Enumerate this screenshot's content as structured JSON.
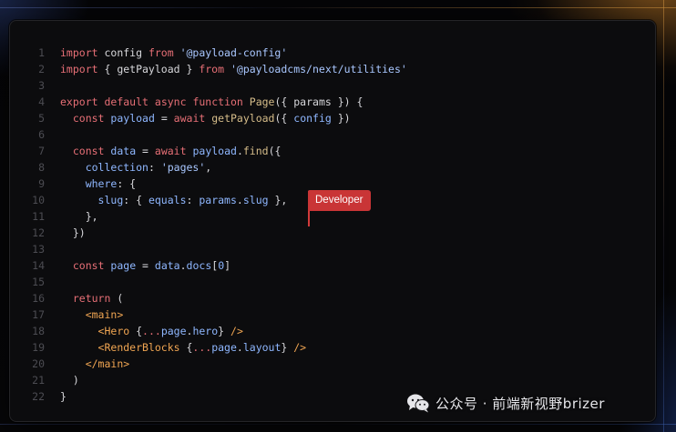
{
  "editor": {
    "lines": [
      {
        "num": "1",
        "tokens": [
          {
            "t": "import",
            "c": "kw"
          },
          {
            "t": " config ",
            "c": "punc"
          },
          {
            "t": "from",
            "c": "kw"
          },
          {
            "t": " ",
            "c": "punc"
          },
          {
            "t": "'@payload-config'",
            "c": "str"
          }
        ]
      },
      {
        "num": "2",
        "tokens": [
          {
            "t": "import",
            "c": "kw"
          },
          {
            "t": " { getPayload } ",
            "c": "punc"
          },
          {
            "t": "from",
            "c": "kw"
          },
          {
            "t": " ",
            "c": "punc"
          },
          {
            "t": "'@payloadcms/next/utilities'",
            "c": "str"
          }
        ]
      },
      {
        "num": "3",
        "tokens": []
      },
      {
        "num": "4",
        "tokens": [
          {
            "t": "export",
            "c": "kw"
          },
          {
            "t": " ",
            "c": "punc"
          },
          {
            "t": "default",
            "c": "kw"
          },
          {
            "t": " ",
            "c": "punc"
          },
          {
            "t": "async",
            "c": "kw"
          },
          {
            "t": " ",
            "c": "punc"
          },
          {
            "t": "function",
            "c": "kw"
          },
          {
            "t": " ",
            "c": "punc"
          },
          {
            "t": "Page",
            "c": "fn"
          },
          {
            "t": "({ params }) {",
            "c": "punc"
          }
        ]
      },
      {
        "num": "5",
        "tokens": [
          {
            "t": "  ",
            "c": "punc"
          },
          {
            "t": "const",
            "c": "kw"
          },
          {
            "t": " ",
            "c": "punc"
          },
          {
            "t": "payload",
            "c": "prop"
          },
          {
            "t": " = ",
            "c": "punc"
          },
          {
            "t": "await",
            "c": "kw"
          },
          {
            "t": " ",
            "c": "punc"
          },
          {
            "t": "getPayload",
            "c": "fn"
          },
          {
            "t": "({ ",
            "c": "punc"
          },
          {
            "t": "config",
            "c": "prop"
          },
          {
            "t": " })",
            "c": "punc"
          }
        ]
      },
      {
        "num": "6",
        "tokens": []
      },
      {
        "num": "7",
        "tokens": [
          {
            "t": "  ",
            "c": "punc"
          },
          {
            "t": "const",
            "c": "kw"
          },
          {
            "t": " ",
            "c": "punc"
          },
          {
            "t": "data",
            "c": "prop"
          },
          {
            "t": " = ",
            "c": "punc"
          },
          {
            "t": "await",
            "c": "kw"
          },
          {
            "t": " ",
            "c": "punc"
          },
          {
            "t": "payload",
            "c": "prop"
          },
          {
            "t": ".",
            "c": "punc"
          },
          {
            "t": "find",
            "c": "fn"
          },
          {
            "t": "({",
            "c": "punc"
          }
        ]
      },
      {
        "num": "8",
        "tokens": [
          {
            "t": "    ",
            "c": "punc"
          },
          {
            "t": "collection",
            "c": "prop"
          },
          {
            "t": ": ",
            "c": "punc"
          },
          {
            "t": "'pages'",
            "c": "str"
          },
          {
            "t": ",",
            "c": "punc"
          }
        ]
      },
      {
        "num": "9",
        "tokens": [
          {
            "t": "    ",
            "c": "punc"
          },
          {
            "t": "where",
            "c": "prop"
          },
          {
            "t": ": {",
            "c": "punc"
          }
        ]
      },
      {
        "num": "10",
        "tokens": [
          {
            "t": "      ",
            "c": "punc"
          },
          {
            "t": "slug",
            "c": "prop"
          },
          {
            "t": ": { ",
            "c": "punc"
          },
          {
            "t": "equals",
            "c": "prop"
          },
          {
            "t": ": ",
            "c": "punc"
          },
          {
            "t": "params",
            "c": "prop"
          },
          {
            "t": ".",
            "c": "punc"
          },
          {
            "t": "slug",
            "c": "prop"
          },
          {
            "t": " },",
            "c": "punc"
          }
        ]
      },
      {
        "num": "11",
        "tokens": [
          {
            "t": "    },",
            "c": "punc"
          }
        ]
      },
      {
        "num": "12",
        "tokens": [
          {
            "t": "  })",
            "c": "punc"
          }
        ]
      },
      {
        "num": "13",
        "tokens": []
      },
      {
        "num": "14",
        "tokens": [
          {
            "t": "  ",
            "c": "punc"
          },
          {
            "t": "const",
            "c": "kw"
          },
          {
            "t": " ",
            "c": "punc"
          },
          {
            "t": "page",
            "c": "prop"
          },
          {
            "t": " = ",
            "c": "punc"
          },
          {
            "t": "data",
            "c": "prop"
          },
          {
            "t": ".",
            "c": "punc"
          },
          {
            "t": "docs",
            "c": "prop"
          },
          {
            "t": "[",
            "c": "punc"
          },
          {
            "t": "0",
            "c": "num"
          },
          {
            "t": "]",
            "c": "punc"
          }
        ]
      },
      {
        "num": "15",
        "tokens": []
      },
      {
        "num": "16",
        "tokens": [
          {
            "t": "  ",
            "c": "punc"
          },
          {
            "t": "return",
            "c": "kw"
          },
          {
            "t": " (",
            "c": "punc"
          }
        ]
      },
      {
        "num": "17",
        "tokens": [
          {
            "t": "    ",
            "c": "punc"
          },
          {
            "t": "<main>",
            "c": "tag"
          }
        ]
      },
      {
        "num": "18",
        "tokens": [
          {
            "t": "      ",
            "c": "punc"
          },
          {
            "t": "<Hero",
            "c": "tag"
          },
          {
            "t": " {",
            "c": "punc"
          },
          {
            "t": "...",
            "c": "kw"
          },
          {
            "t": "page",
            "c": "prop"
          },
          {
            "t": ".",
            "c": "punc"
          },
          {
            "t": "hero",
            "c": "prop"
          },
          {
            "t": "} ",
            "c": "punc"
          },
          {
            "t": "/>",
            "c": "tag"
          }
        ]
      },
      {
        "num": "19",
        "tokens": [
          {
            "t": "      ",
            "c": "punc"
          },
          {
            "t": "<RenderBlocks",
            "c": "tag"
          },
          {
            "t": " {",
            "c": "punc"
          },
          {
            "t": "...",
            "c": "kw"
          },
          {
            "t": "page",
            "c": "prop"
          },
          {
            "t": ".",
            "c": "punc"
          },
          {
            "t": "layout",
            "c": "prop"
          },
          {
            "t": "} ",
            "c": "punc"
          },
          {
            "t": "/>",
            "c": "tag"
          }
        ]
      },
      {
        "num": "20",
        "tokens": [
          {
            "t": "    ",
            "c": "punc"
          },
          {
            "t": "</main>",
            "c": "tag"
          }
        ]
      },
      {
        "num": "21",
        "tokens": [
          {
            "t": "  )",
            "c": "punc"
          }
        ]
      },
      {
        "num": "22",
        "tokens": [
          {
            "t": "}",
            "c": "punc"
          }
        ]
      }
    ]
  },
  "collab_cursor": {
    "label": "Developer",
    "color": "#c93536"
  },
  "watermark": {
    "icon": "wechat-icon",
    "text": "公众号 · 前端新视野brizer"
  },
  "colors": {
    "keyword": "#e76f76",
    "string": "#a9c7ff",
    "function": "#d6bd8a",
    "tag": "#f0a552",
    "property": "#8fb7ff",
    "line_number": "#4c4c52",
    "background": "#0c0c0e"
  }
}
